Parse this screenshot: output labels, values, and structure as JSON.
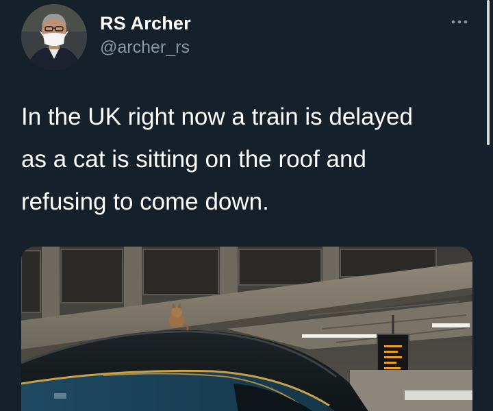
{
  "tweet": {
    "author_name": "RS Archer",
    "author_handle": "@archer_rs",
    "avatar_icon": "avatar-photo-masked-man",
    "more_icon": "more-options-icon",
    "text_lines": [
      "In the UK right now a train is delayed",
      "as a cat is sitting on the roof and",
      "refusing to come down."
    ],
    "media_description_icon": "photo-cat-on-train-roof"
  },
  "colors": {
    "background": "#15202b",
    "text_primary": "#ffffff",
    "text_secondary": "#8b98a5",
    "scrollbar": "#d9d9d9"
  }
}
